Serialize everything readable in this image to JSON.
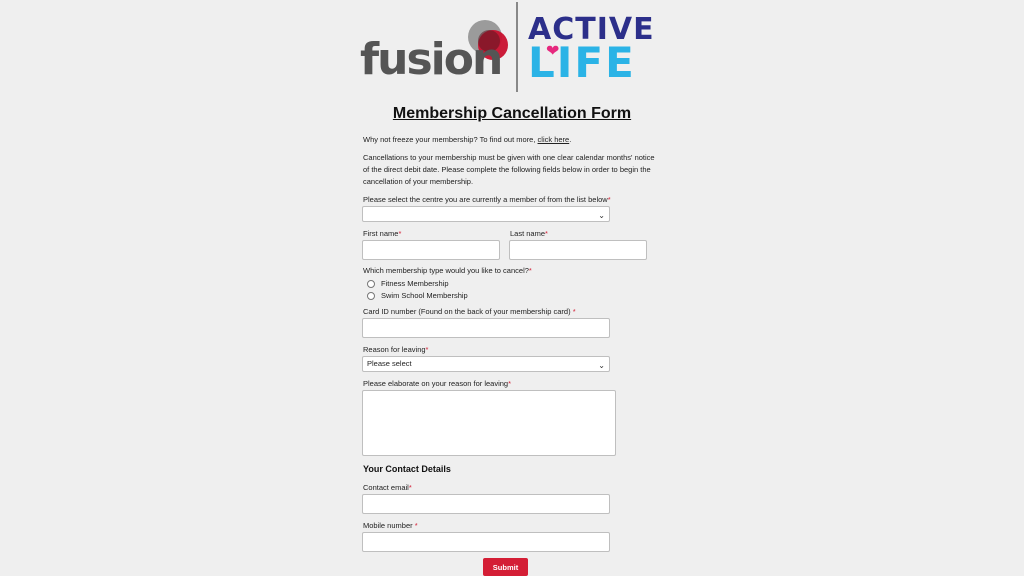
{
  "logos": {
    "fusion": "fusion",
    "active": "ACTIVE",
    "life": "LIFE"
  },
  "form": {
    "title": "Membership Cancellation Form",
    "freeze_prefix": "Why not freeze your membership? To find out more, ",
    "freeze_link": "click here",
    "freeze_suffix": ".",
    "notice_line1": "Cancellations to your membership must be given with one clear calendar months' notice",
    "notice_line2": "of the direct debit date. Please complete the following fields below in order to begin the",
    "notice_line3": "cancellation of your membership.",
    "centre_label": "Please select the centre you are currently a member of from the list below",
    "centre_value": "",
    "first_name_label": "First name",
    "last_name_label": "Last name",
    "membership_type_label": "Which membership type would you like to cancel?",
    "membership_options": [
      "Fitness Membership",
      "Swim School Membership"
    ],
    "card_id_label": "Card ID number (Found on the back of your membership card) ",
    "reason_label": "Reason for leaving",
    "reason_value": "Please select",
    "elaborate_label": "Please elaborate on your reason for leaving",
    "contact_heading": "Your Contact Details",
    "email_label": "Contact email",
    "mobile_label": "Mobile number ",
    "required_mark": "*",
    "submit_label": "Submit"
  },
  "colors": {
    "accent_red": "#d41e35",
    "active_blue": "#2c2f8a",
    "life_cyan": "#2bb3e6",
    "heart_pink": "#e6287e",
    "background": "#efefef"
  }
}
